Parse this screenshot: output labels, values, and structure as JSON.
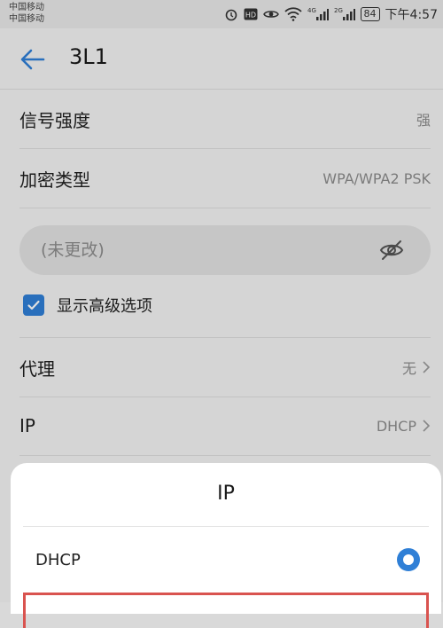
{
  "status": {
    "carrier_line1": "中国移动",
    "carrier_line2": "中国移动",
    "net1": "4G",
    "net2": "2G",
    "battery": "84",
    "time": "下午4:57"
  },
  "header": {
    "title": "3L1"
  },
  "rows": {
    "signal": {
      "label": "信号强度",
      "value": "强"
    },
    "security": {
      "label": "加密类型",
      "value": "WPA/WPA2 PSK"
    },
    "proxy": {
      "label": "代理",
      "value": "无"
    },
    "ip": {
      "label": "IP",
      "value": "DHCP"
    }
  },
  "password": {
    "placeholder": "(未更改)"
  },
  "advanced": {
    "label": "显示高级选项",
    "checked": true
  },
  "sheet": {
    "title": "IP",
    "options": [
      {
        "label": "DHCP",
        "selected": true
      }
    ]
  },
  "colors": {
    "accent": "#2f7fd6",
    "highlight": "#d9534f"
  }
}
